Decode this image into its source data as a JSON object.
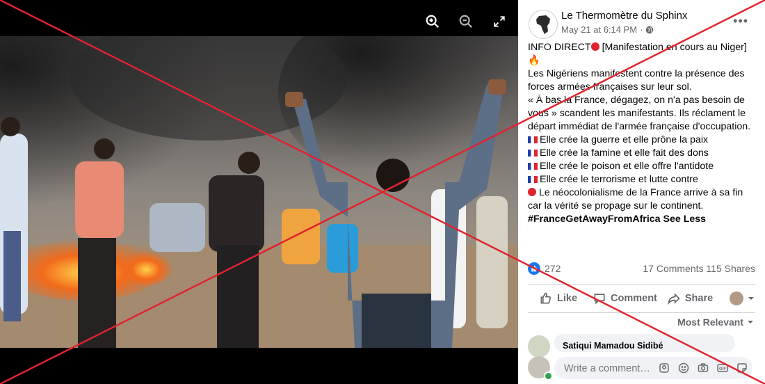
{
  "post": {
    "page_name": "Le Thermomètre du Sphinx",
    "timestamp": "May 21 at 6:14 PM",
    "privacy_icon": "globe-icon",
    "lines": [
      {
        "prefix": "",
        "text": "INFO DIRECT",
        "suffix_dot": true,
        "rest": " [Manifestation en cours au Niger] "
      },
      {
        "text": "Les Nigériens manifestent contre la présence des forces armées françaises sur leur sol."
      },
      {
        "text": "« À bas la France, dégagez, on n'a pas besoin de vous » scandent les manifestants. Ils réclament le départ immédiat de l'armée française d'occupation."
      },
      {
        "text": "Elle crée la guerre et elle prône la paix"
      },
      {
        "text": "Elle crée la famine et elle fait des dons"
      },
      {
        "text": "Elle crée le poison et elle offre l'antidote"
      },
      {
        "text": "Elle crée le terrorisme et lutte contre"
      },
      {
        "text": " Le néocolonialisme de la France arrive à sa fin car la vérité se propage sur le continent."
      }
    ],
    "hashtag": "#FranceGetAwayFromAfrica",
    "see_less": "See Less"
  },
  "stats": {
    "reactions": "272",
    "comments": "17 Comments",
    "shares": "115 Shares"
  },
  "actions": {
    "like": "Like",
    "comment": "Comment",
    "share": "Share"
  },
  "comments": {
    "sort_label": "Most Relevant",
    "first_commenter": "Satiqui Mamadou Sidibé",
    "compose_placeholder": "Write a comment…"
  },
  "colors": {
    "cross": "#e0232f",
    "facebook_blue": "#1877f2",
    "muted": "#65676b"
  }
}
